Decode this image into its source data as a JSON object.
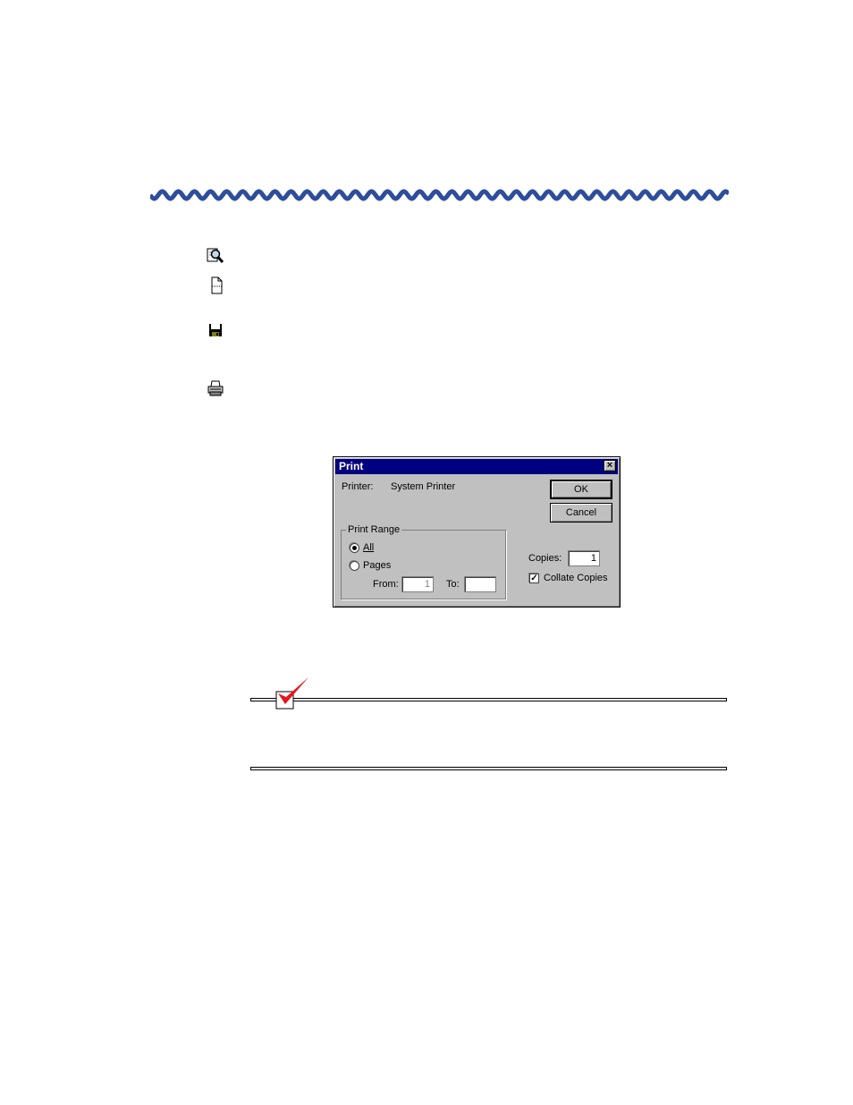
{
  "dialog": {
    "title": "Print",
    "close_glyph": "×",
    "printer_label": "Printer:",
    "printer_value": "System Printer",
    "ok_label": "OK",
    "cancel_label": "Cancel",
    "print_range_label": "Print Range",
    "all_label": "All",
    "pages_label": "Pages",
    "from_label": "From:",
    "from_value": "1",
    "to_label": "To:",
    "to_value": "",
    "copies_label": "Copies:",
    "copies_value": "1",
    "collate_label": "Collate Copies",
    "collate_checked": true,
    "selected_range": "All"
  },
  "icons": [
    "zoom-icon",
    "page-icon",
    "floppy-disk-icon",
    "printer-icon"
  ],
  "colors": {
    "wave": "#2e4d9a",
    "titlebar": "#000080",
    "dialog_face": "#c0c0c0",
    "checkmark": "#e8151b"
  }
}
